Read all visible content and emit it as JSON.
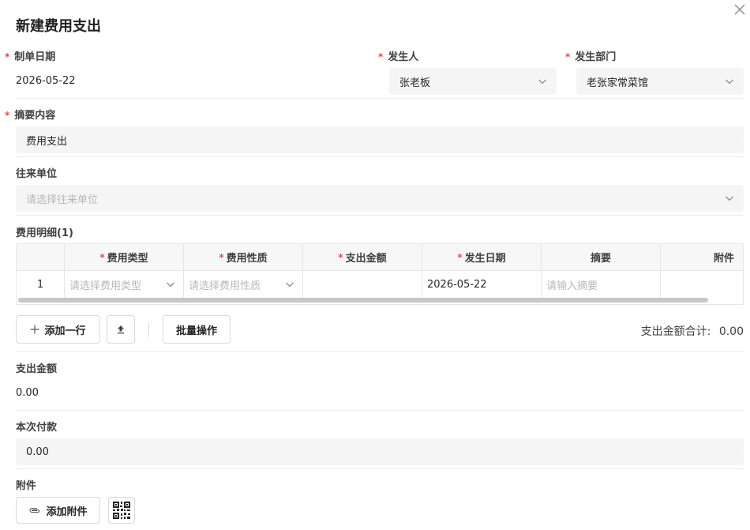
{
  "dialog": {
    "title": "新建费用支出"
  },
  "form": {
    "date": {
      "label": "制单日期",
      "value": "2026-05-22"
    },
    "person": {
      "label": "发生人",
      "value": "张老板"
    },
    "department": {
      "label": "发生部门",
      "value": "老张家常菜馆"
    },
    "summary": {
      "label": "摘要内容",
      "value": "费用支出"
    },
    "partner": {
      "label": "往来单位",
      "placeholder": "请选择往来单位"
    }
  },
  "details": {
    "label": "费用明细(1)",
    "columns": [
      "",
      "费用类型",
      "费用性质",
      "支出金额",
      "发生日期",
      "摘要",
      "附件"
    ],
    "row": {
      "index": "1",
      "type_placeholder": "请选择费用类型",
      "nature_placeholder": "请选择费用性质",
      "amount": "",
      "date": "2026-05-22",
      "summary_placeholder": "请输入摘要",
      "attachment": ""
    },
    "add_row_label": "添加一行",
    "batch_label": "批量操作",
    "total_label": "支出金额合计:",
    "total_value": "0.00"
  },
  "amount": {
    "label": "支出金额",
    "value": "0.00"
  },
  "payment": {
    "label": "本次付款",
    "value": "0.00"
  },
  "attachment": {
    "label": "附件",
    "add_label": "添加附件"
  },
  "required_mark": "*"
}
